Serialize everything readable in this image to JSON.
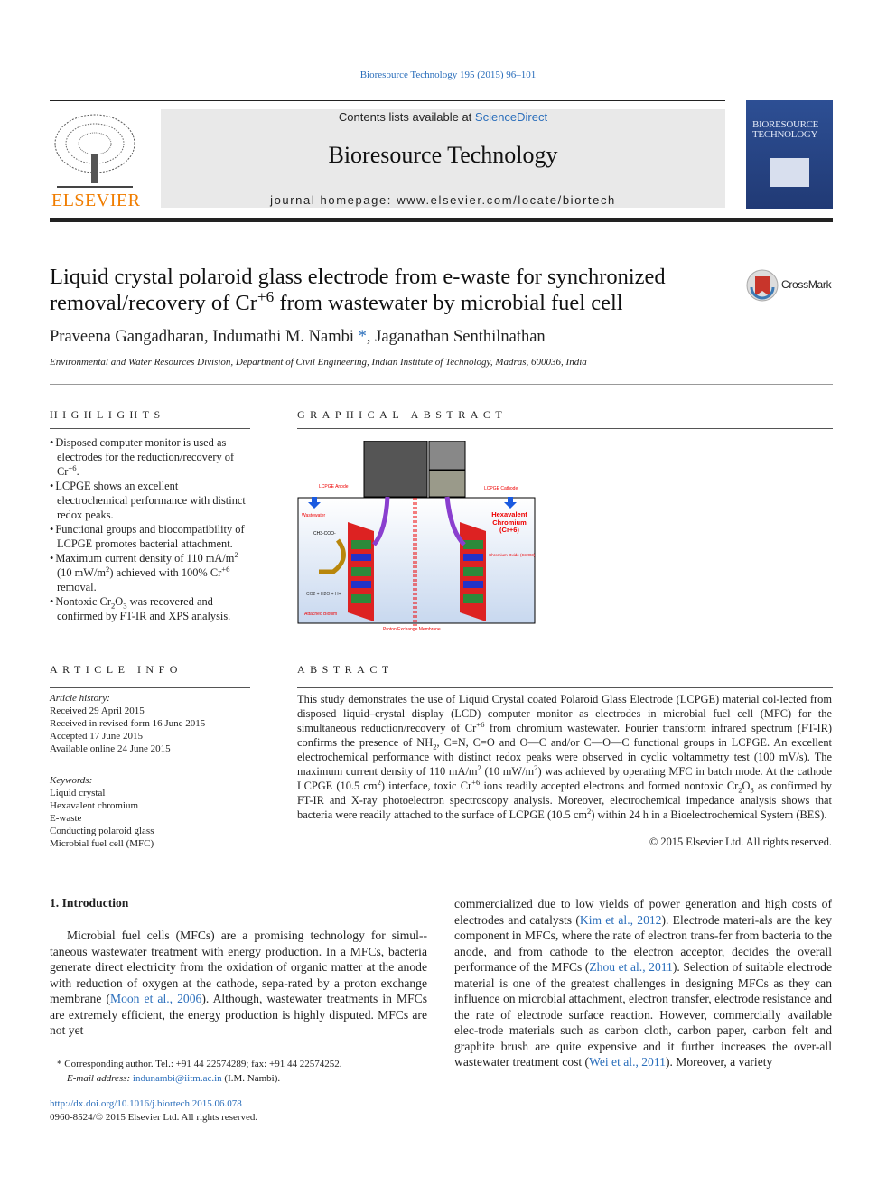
{
  "header": {
    "citation": "Bioresource Technology 195 (2015) 96–101",
    "contents_prefix": "Contents lists available at ",
    "contents_link": "ScienceDirect",
    "journal_title": "Bioresource Technology",
    "homepage": "journal homepage: www.elsevier.com/locate/biortech",
    "publisher_logo": "ELSEVIER",
    "cover_title": "BIORESOURCE TECHNOLOGY",
    "crossmark": "CrossMark"
  },
  "article": {
    "title": [
      {
        "t": "Liquid crystal polaroid glass electrode from e-waste for synchronized removal/recovery of Cr"
      },
      {
        "t": "+6",
        "s": "sup"
      },
      {
        "t": " from wastewater by microbial fuel cell"
      }
    ],
    "authors": [
      {
        "t": "Praveena Gangadharan, Indumathi M. Nambi"
      },
      {
        "t": " *",
        "s": "link"
      },
      {
        "t": ", Jaganathan Senthilnathan"
      }
    ],
    "affiliation": "Environmental and Water Resources Division, Department of Civil Engineering, Indian Institute of Technology, Madras, 600036, India"
  },
  "highlights": {
    "heading": "HIGHLIGHTS",
    "items": [
      [
        {
          "t": "Disposed computer monitor is used as electrodes for the reduction/recovery of Cr"
        },
        {
          "t": "+6",
          "s": "sup"
        },
        {
          "t": "."
        }
      ],
      [
        {
          "t": "LCPGE shows an excellent electrochemical performance with distinct redox peaks."
        }
      ],
      [
        {
          "t": "Functional groups and biocompatibility of LCPGE promotes bacterial attachment."
        }
      ],
      [
        {
          "t": "Maximum current density of 110 mA/m"
        },
        {
          "t": "2",
          "s": "sup"
        },
        {
          "t": " (10 mW/m"
        },
        {
          "t": "2",
          "s": "sup"
        },
        {
          "t": ") achieved with 100% Cr"
        },
        {
          "t": "+6",
          "s": "sup"
        },
        {
          "t": " removal."
        }
      ],
      [
        {
          "t": "Nontoxic Cr"
        },
        {
          "t": "2",
          "s": "sub"
        },
        {
          "t": "O"
        },
        {
          "t": "3",
          "s": "sub"
        },
        {
          "t": " was recovered and confirmed by FT-IR and XPS analysis."
        }
      ]
    ]
  },
  "graphical_abstract": {
    "heading": "GRAPHICAL ABSTRACT",
    "labels": {
      "anode": "LCPGE Anode",
      "cathode": "LCPGE Cathode",
      "wastewater": "Wastewater",
      "hexavalent": "Hexavalent Chromium (Cr+6)",
      "oxide": "Chromium Oxide (Cr2O3)",
      "biofilm": "Attached Biofilm",
      "membrane": "Proton Exchange Membrane",
      "acetate": "CH3-COO-",
      "products": "CO2 + H2O + H+"
    }
  },
  "article_info": {
    "heading": "ARTICLE INFO",
    "history_label": "Article history:",
    "history": [
      "Received 29 April 2015",
      "Received in revised form 16 June 2015",
      "Accepted 17 June 2015",
      "Available online 24 June 2015"
    ],
    "keywords_label": "Keywords:",
    "keywords": [
      "Liquid crystal",
      "Hexavalent chromium",
      "E-waste",
      "Conducting polaroid glass",
      "Microbial fuel cell (MFC)"
    ]
  },
  "abstract": {
    "heading": "ABSTRACT",
    "body": [
      {
        "t": "This study demonstrates the use of Liquid Crystal coated Polaroid Glass Electrode (LCPGE) material col-­lected from disposed liquid–crystal display (LCD) computer monitor as electrodes in microbial fuel cell (MFC) for the simultaneous reduction/recovery of Cr"
      },
      {
        "t": "+6",
        "s": "sup"
      },
      {
        "t": " from chromium wastewater. Fourier transform infrared spectrum (FT-IR) confirms the presence of NH"
      },
      {
        "t": "2",
        "s": "sub"
      },
      {
        "t": ", C≡N, C=O and O—C and/or C—O—C functional groups in LCPGE. An excellent electrochemical performance with distinct redox peaks were observed in cyclic voltammetry test (100 mV/s). The maximum current density of 110 mA/m"
      },
      {
        "t": "2",
        "s": "sup"
      },
      {
        "t": " (10 mW/m"
      },
      {
        "t": "2",
        "s": "sup"
      },
      {
        "t": ") was achieved by operating MFC in batch mode. At the cathode LCPGE (10.5 cm"
      },
      {
        "t": "2",
        "s": "sup"
      },
      {
        "t": ") interface, toxic Cr"
      },
      {
        "t": "+6",
        "s": "sup"
      },
      {
        "t": " ions readily accepted electrons and formed nontoxic Cr"
      },
      {
        "t": "2",
        "s": "sub"
      },
      {
        "t": "O"
      },
      {
        "t": "3",
        "s": "sub"
      },
      {
        "t": " as confirmed by FT-IR and X-ray photoelectron spectroscopy analysis. Moreover, electrochemical impedance analysis shows that bacteria were readily attached to the surface of LCPGE (10.5 cm"
      },
      {
        "t": "2",
        "s": "sup"
      },
      {
        "t": ") within 24 h in a Bioelectrochemical System (BES)."
      }
    ],
    "copyright": "© 2015 Elsevier Ltd. All rights reserved."
  },
  "body": {
    "section_heading": "1. Introduction",
    "left_para": [
      {
        "t": "Microbial fuel cells (MFCs) are a promising technology for simul-­taneous wastewater treatment with energy production. In a MFCs, bacteria generate direct electricity from the oxidation of organic matter at the anode with reduction of oxygen at the cathode, sepa-­rated by a proton exchange membrane ("
      },
      {
        "t": "Moon et al., 2006",
        "s": "link"
      },
      {
        "t": "). Although, wastewater treatments in MFCs are extremely efficient, the energy production is highly disputed. MFCs are not yet"
      }
    ],
    "right_para": [
      {
        "t": "commercialized due to low yields of power generation and high costs of electrodes and catalysts ("
      },
      {
        "t": "Kim et al., 2012",
        "s": "link"
      },
      {
        "t": "). Electrode materi-­als are the key component in MFCs, where the rate of electron trans-­fer from bacteria to the anode, and from cathode to the electron acceptor, decides the overall performance of the MFCs ("
      },
      {
        "t": "Zhou et al., 2011",
        "s": "link"
      },
      {
        "t": "). Selection of suitable electrode material is one of the greatest challenges in designing MFCs as they can influence on microbial attachment, electron transfer, electrode resistance and the rate of electrode surface reaction. However, commercially available elec-­trode materials such as carbon cloth, carbon paper, carbon felt and graphite brush are quite expensive and it further increases the over-­all wastewater treatment cost ("
      },
      {
        "t": "Wei et al., 2011",
        "s": "link"
      },
      {
        "t": "). Moreover, a variety"
      }
    ]
  },
  "footnote": {
    "corresponding": "* Corresponding author. Tel.: +91 44 22574289; fax: +91 44 22574252.",
    "email_label": "E-mail address: ",
    "email": "indunambi@iitm.ac.in",
    "email_suffix": " (I.M. Nambi).",
    "doi": "http://dx.doi.org/10.1016/j.biortech.2015.06.078",
    "issn": "0960-8524/© 2015 Elsevier Ltd. All rights reserved."
  },
  "colors": {
    "link": "#2a6ebb",
    "elsevier_orange": "#f07d00",
    "cover_blue": "#2b4a8c",
    "band_gray": "#e9e9e9"
  }
}
